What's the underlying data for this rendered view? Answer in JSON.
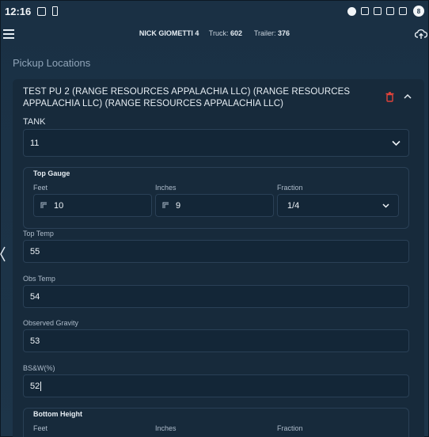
{
  "status_bar": {
    "time": "12:16",
    "battery": "8"
  },
  "header": {
    "driver": "NICK GIOMETTI 4",
    "truck_label": "Truck:",
    "truck_value": "602",
    "trailer_label": "Trailer:",
    "trailer_value": "376"
  },
  "section_title": "Pickup Locations",
  "pickup": {
    "title": "TEST PU 2 (RANGE RESOURCES APPALACHIA LLC) (RANGE RESOURCES APPALACHIA LLC) (RANGE RESOURCES APPALACHIA LLC)",
    "tank_label": "TANK",
    "tank_value": "11",
    "top_gauge": {
      "title": "Top Gauge",
      "feet_label": "Feet",
      "feet_value": "10",
      "inches_label": "Inches",
      "inches_value": "9",
      "fraction_label": "Fraction",
      "fraction_value": "1/4"
    },
    "top_temp_label": "Top Temp",
    "top_temp_value": "55",
    "obs_temp_label": "Obs Temp",
    "obs_temp_value": "54",
    "observed_gravity_label": "Observed Gravity",
    "observed_gravity_value": "53",
    "bsw_label": "BS&W(%)",
    "bsw_value": "52",
    "bottom_height": {
      "title": "Bottom Height",
      "feet_label": "Feet",
      "inches_label": "Inches",
      "fraction_label": "Fraction"
    }
  },
  "colors": {
    "background": "#1c3246",
    "card": "#172a3b",
    "field": "#132637",
    "border": "#2a4056",
    "delete": "#e0433a"
  }
}
